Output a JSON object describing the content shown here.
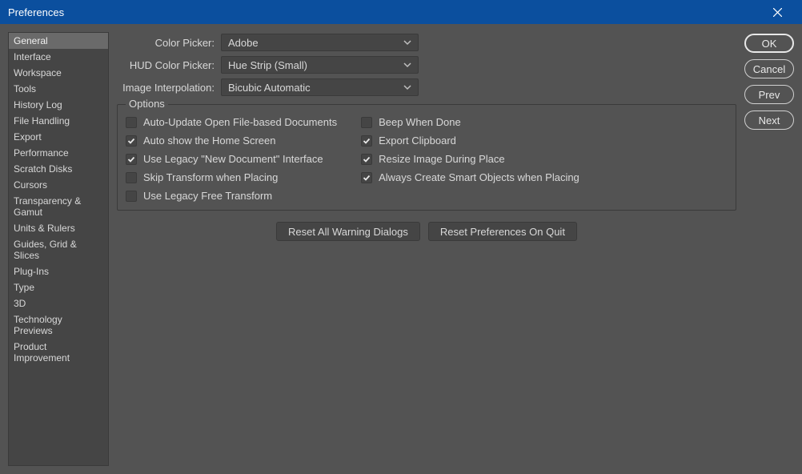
{
  "title": "Preferences",
  "sidebar": {
    "items": [
      {
        "label": "General",
        "selected": true
      },
      {
        "label": "Interface"
      },
      {
        "label": "Workspace"
      },
      {
        "label": "Tools"
      },
      {
        "label": "History Log"
      },
      {
        "label": "File Handling"
      },
      {
        "label": "Export"
      },
      {
        "label": "Performance"
      },
      {
        "label": "Scratch Disks"
      },
      {
        "label": "Cursors"
      },
      {
        "label": "Transparency & Gamut"
      },
      {
        "label": "Units & Rulers"
      },
      {
        "label": "Guides, Grid & Slices"
      },
      {
        "label": "Plug-Ins"
      },
      {
        "label": "Type"
      },
      {
        "label": "3D"
      },
      {
        "label": "Technology Previews"
      },
      {
        "label": "Product Improvement"
      }
    ]
  },
  "form": {
    "colorPicker": {
      "label": "Color Picker:",
      "value": "Adobe"
    },
    "hudColorPicker": {
      "label": "HUD Color Picker:",
      "value": "Hue Strip (Small)"
    },
    "imageInterpolation": {
      "label": "Image Interpolation:",
      "value": "Bicubic Automatic"
    }
  },
  "options": {
    "legend": "Options",
    "left": [
      {
        "label": "Auto-Update Open File-based Documents",
        "checked": false
      },
      {
        "label": "Auto show the Home Screen",
        "checked": true
      },
      {
        "label": "Use Legacy \"New Document\" Interface",
        "checked": true
      },
      {
        "label": "Skip Transform when Placing",
        "checked": false
      },
      {
        "label": "Use Legacy Free Transform",
        "checked": false
      }
    ],
    "right": [
      {
        "label": "Beep When Done",
        "checked": false
      },
      {
        "label": "Export Clipboard",
        "checked": true
      },
      {
        "label": "Resize Image During Place",
        "checked": true
      },
      {
        "label": "Always Create Smart Objects when Placing",
        "checked": true
      }
    ]
  },
  "resetButtons": {
    "resetWarnings": "Reset All Warning Dialogs",
    "resetPrefs": "Reset Preferences On Quit"
  },
  "actions": {
    "ok": "OK",
    "cancel": "Cancel",
    "prev": "Prev",
    "next": "Next"
  }
}
